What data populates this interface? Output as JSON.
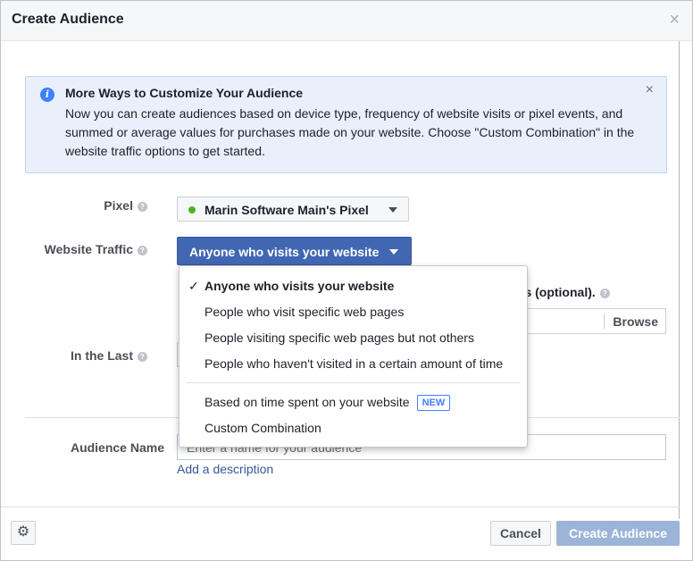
{
  "dialog": {
    "title": "Create Audience",
    "close_icon": "close-icon"
  },
  "info": {
    "title": "More Ways to Customize Your Audience",
    "text": "Now you can create audiences based on device type, frequency of website visits or pixel events, and summed or average values for purchases made on your website. Choose \"Custom Combination\" in the website traffic options to get started.",
    "icon": "info-icon",
    "close_glyph": "×"
  },
  "form": {
    "pixel_label": "Pixel",
    "pixel_value": "Marin Software Main's Pixel",
    "traffic_label": "Website Traffic",
    "traffic_value": "Anyone who visits your website",
    "behind_text": "ins (optional).",
    "browse_label": "Browse",
    "in_the_last_label": "In the Last",
    "audience_name_label": "Audience Name",
    "audience_name_placeholder": "Enter a name for your audience",
    "add_description": "Add a description"
  },
  "dropdown": {
    "items": [
      {
        "label": "Anyone who visits your website",
        "selected": true
      },
      {
        "label": "People who visit specific web pages"
      },
      {
        "label": "People visiting specific web pages but not others"
      },
      {
        "label": "People who haven't visited in a certain amount of time"
      },
      {
        "label": "Based on time spent on your website",
        "badge": "NEW"
      },
      {
        "label": "Custom Combination"
      }
    ],
    "check_glyph": "✓"
  },
  "footer": {
    "cancel": "Cancel",
    "create": "Create Audience",
    "gear_icon": "gear-icon"
  },
  "colors": {
    "primary": "#4267b2",
    "primary_disabled": "#9cb4d8",
    "info_bg": "#e9f0fb",
    "pixel_active": "#42b72a",
    "new_badge": "#4080ff"
  }
}
